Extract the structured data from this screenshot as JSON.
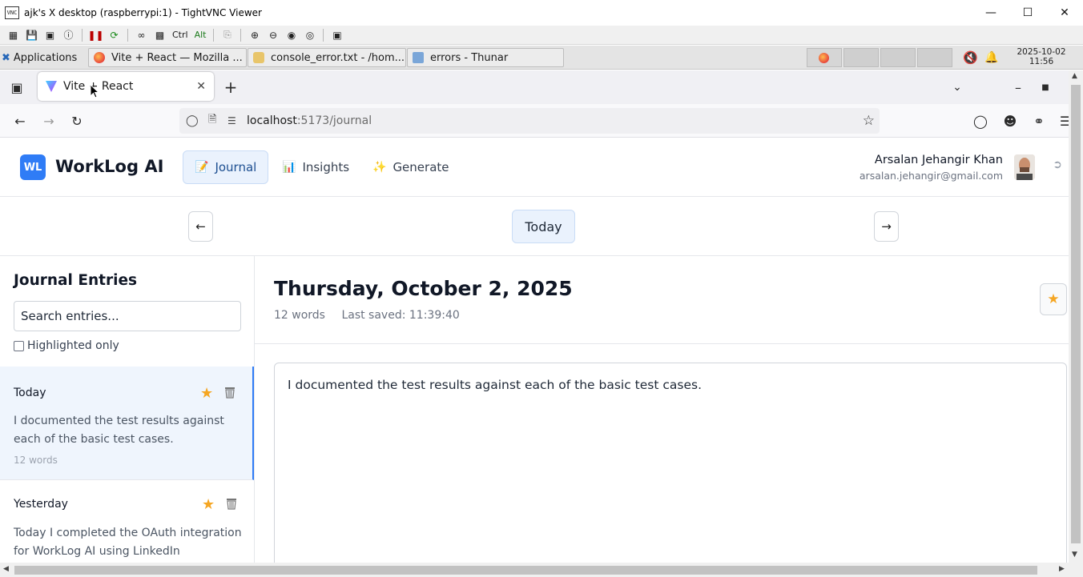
{
  "vnc_window": {
    "title": "ajk's X desktop (raspberrypi:1) - TightVNC Viewer",
    "toolbar_text_buttons": [
      "Ctrl",
      "Alt"
    ]
  },
  "panel": {
    "applications_label": "Applications",
    "tasks": [
      {
        "label": "Vite + React — Mozilla ...",
        "icon": "firefox-icon"
      },
      {
        "label": "console_error.txt - /hom...",
        "icon": "text-editor-icon"
      },
      {
        "label": "errors - Thunar",
        "icon": "folder-icon"
      }
    ],
    "clock_date": "2025-10-02",
    "clock_time": "11:56"
  },
  "browser": {
    "tab_title": "Vite + React",
    "url_host": "localhost",
    "url_path": ":5173/journal"
  },
  "app": {
    "logo_initials": "WL",
    "name": "WorkLog AI",
    "nav": [
      {
        "label": "Journal",
        "emoji": "📝",
        "active": true
      },
      {
        "label": "Insights",
        "emoji": "📊",
        "active": false
      },
      {
        "label": "Generate",
        "emoji": "✨",
        "active": false
      }
    ],
    "user": {
      "name": "Arsalan Jehangir Khan",
      "email": "arsalan.jehangir@gmail.com"
    },
    "date_nav": {
      "prev": "←",
      "today": "Today",
      "next": "→"
    },
    "sidebar": {
      "title": "Journal Entries",
      "search_placeholder": "Search entries...",
      "highlighted_only_label": "Highlighted only",
      "entries": [
        {
          "date": "Today",
          "text": "I documented the test results against each of the basic test cases.",
          "words": "12 words",
          "starred": true,
          "selected": true
        },
        {
          "date": "Yesterday",
          "text": "Today I completed the OAuth integration for WorkLog AI using LinkedIn",
          "words": "",
          "starred": true,
          "selected": false
        }
      ]
    },
    "entry": {
      "date_title": "Thursday, October 2, 2025",
      "word_count": "12 words",
      "last_saved": "Last saved: 11:39:40",
      "body": "I documented the test results against each of the basic test cases."
    },
    "accent_color": "#2f7cf6",
    "star_color": "#f5a623"
  }
}
